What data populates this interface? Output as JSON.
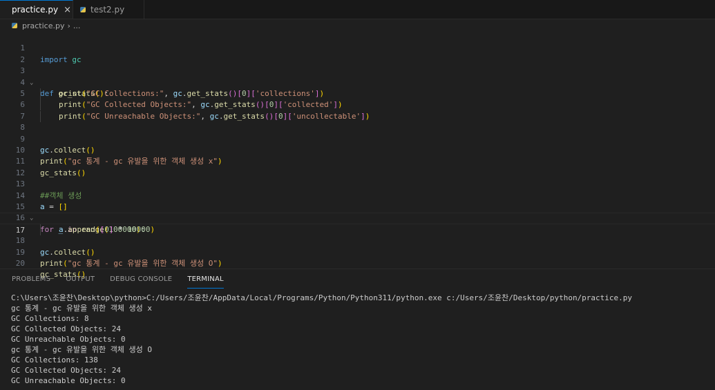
{
  "tabs": [
    {
      "label": "practice.py",
      "close": "×"
    },
    {
      "label": "test2.py"
    }
  ],
  "breadcrumb": {
    "file": "practice.py",
    "sep": "›",
    "more": "..."
  },
  "editor": {
    "line_numbers": [
      "1",
      "2",
      "3",
      "4",
      "5",
      "6",
      "7",
      "8",
      "9",
      "10",
      "11",
      "12",
      "13",
      "14",
      "15",
      "16",
      "17",
      "18",
      "19",
      "20"
    ],
    "l1": {
      "kw": "import",
      "mod": "gc"
    },
    "l3": {
      "kw": "def",
      "fn": "gc_stats",
      "open": "(",
      "close": ")",
      "colon": ":"
    },
    "l4": {
      "fn": "print",
      "str": "\"GC Collections:\"",
      "var": "gc",
      "get": "get_stats",
      "idx": "0",
      "key": "'collections'"
    },
    "l5": {
      "fn": "print",
      "str": "\"GC Collected Objects:\"",
      "var": "gc",
      "get": "get_stats",
      "idx": "0",
      "key": "'collected'"
    },
    "l6": {
      "fn": "print",
      "str": "\"GC Unreachable Objects:\"",
      "var": "gc",
      "get": "get_stats",
      "idx": "0",
      "key": "'uncollectable'"
    },
    "l9": {
      "var": "gc",
      "fn": "collect"
    },
    "l10": {
      "fn": "print",
      "str": "\"gc 통계 - gc 유발을 위한 객체 생성 x\""
    },
    "l11": {
      "fn": "gc_stats"
    },
    "l13": {
      "cmt": "##객체 생성"
    },
    "l14": {
      "var": "a",
      "op": " = ",
      "open": "[",
      "close": "]"
    },
    "l15": {
      "kw": "for",
      "var": "_",
      "kw2": "in",
      "fn": "range",
      "num": "100000"
    },
    "l16": {
      "var": "a",
      "fn": "append",
      "num1": "0",
      "op": " * ",
      "num2": "10000"
    },
    "l18": {
      "var": "gc",
      "fn": "collect"
    },
    "l19": {
      "fn": "print",
      "str": "\"gc 통계 - gc 유발을 위한 객체 생성 O\""
    },
    "l20": {
      "fn": "gc_stats"
    }
  },
  "panel": {
    "tabs": [
      "PROBLEMS",
      "OUTPUT",
      "DEBUG CONSOLE",
      "TERMINAL"
    ],
    "active_tab": "TERMINAL"
  },
  "terminal": {
    "lines": [
      "C:\\Users\\조윤찬\\Desktop\\python>C:/Users/조윤찬/AppData/Local/Programs/Python/Python311/python.exe c:/Users/조윤찬/Desktop/python/practice.py",
      "gc 통계 - gc 유발을 위한 객체 생성 x",
      "GC Collections: 8",
      "GC Collected Objects: 24",
      "GC Unreachable Objects: 0",
      "gc 통계 - gc 유발을 위한 객체 생성 O",
      "GC Collections: 138",
      "GC Collected Objects: 24",
      "GC Unreachable Objects: 0"
    ]
  },
  "colors": {
    "accent": "#0078d4",
    "background": "#1f1f1f",
    "tabbar": "#181818"
  }
}
